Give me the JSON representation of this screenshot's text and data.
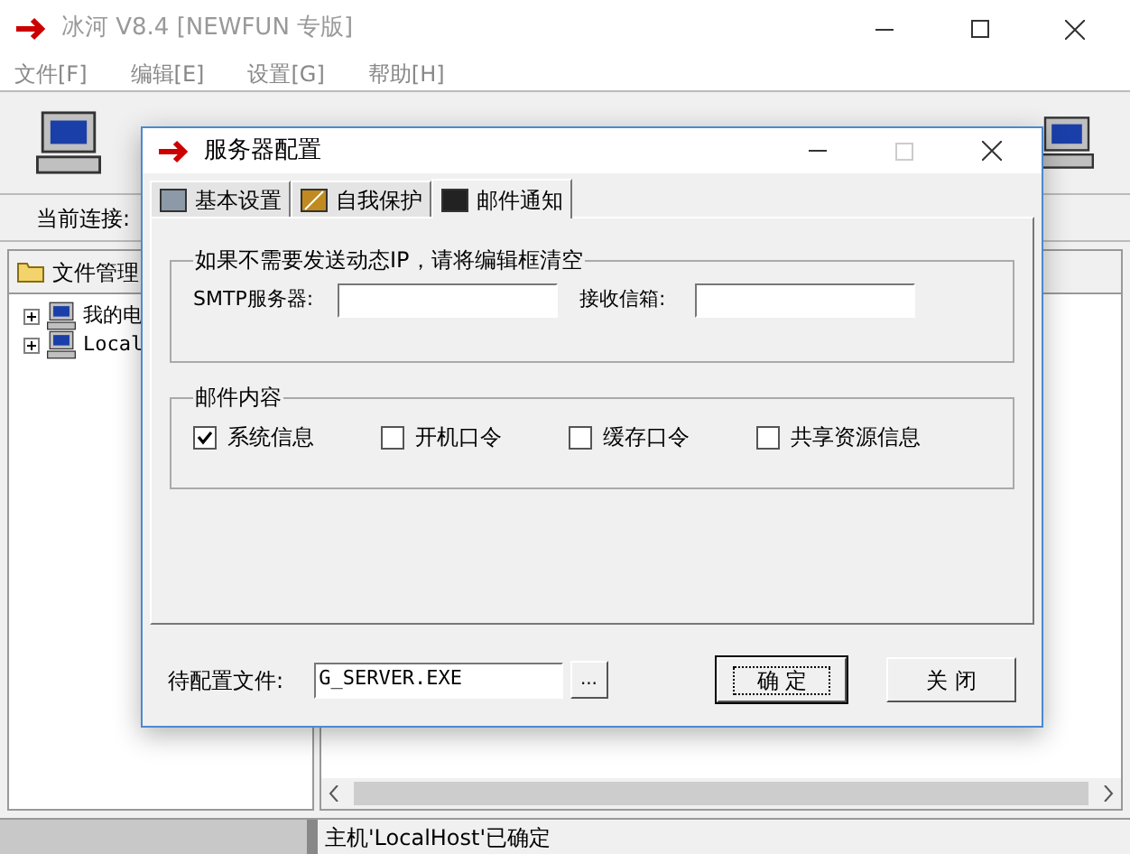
{
  "main_window": {
    "title": "冰河 V8.4 [NEWFUN 专版]",
    "menu": [
      "文件[F]",
      "编辑[E]",
      "设置[G]",
      "帮助[H]"
    ],
    "connection_label": "当前连接:",
    "file_panel": {
      "title": "文件管理",
      "tree": [
        {
          "label": "我的电",
          "expanded": false
        },
        {
          "label": "Local",
          "expanded": false
        }
      ]
    },
    "status_bar": "主机'LocalHost'已确定"
  },
  "dialog": {
    "title": "服务器配置",
    "tabs": [
      {
        "label": "基本设置",
        "selected": false
      },
      {
        "label": "自我保护",
        "selected": false
      },
      {
        "label": "邮件通知",
        "selected": true
      }
    ],
    "ip_group": {
      "title": "如果不需要发送动态IP，请将编辑框清空",
      "fields": [
        {
          "label": "SMTP服务器:"
        },
        {
          "label": "接收信箱:"
        }
      ]
    },
    "content_group": {
      "title": "邮件内容",
      "checkboxes": [
        {
          "label": "系统信息",
          "checked": true
        },
        {
          "label": "开机口令",
          "checked": false
        },
        {
          "label": "缓存口令",
          "checked": false
        },
        {
          "label": "共享资源信息",
          "checked": false
        }
      ]
    },
    "file_label": "待配置文件:",
    "file_value": "G_SERVER.EXE",
    "browse": "...",
    "buttons": [
      {
        "label": "确 定",
        "default": true
      },
      {
        "label": "关 闭",
        "default": false
      }
    ]
  }
}
